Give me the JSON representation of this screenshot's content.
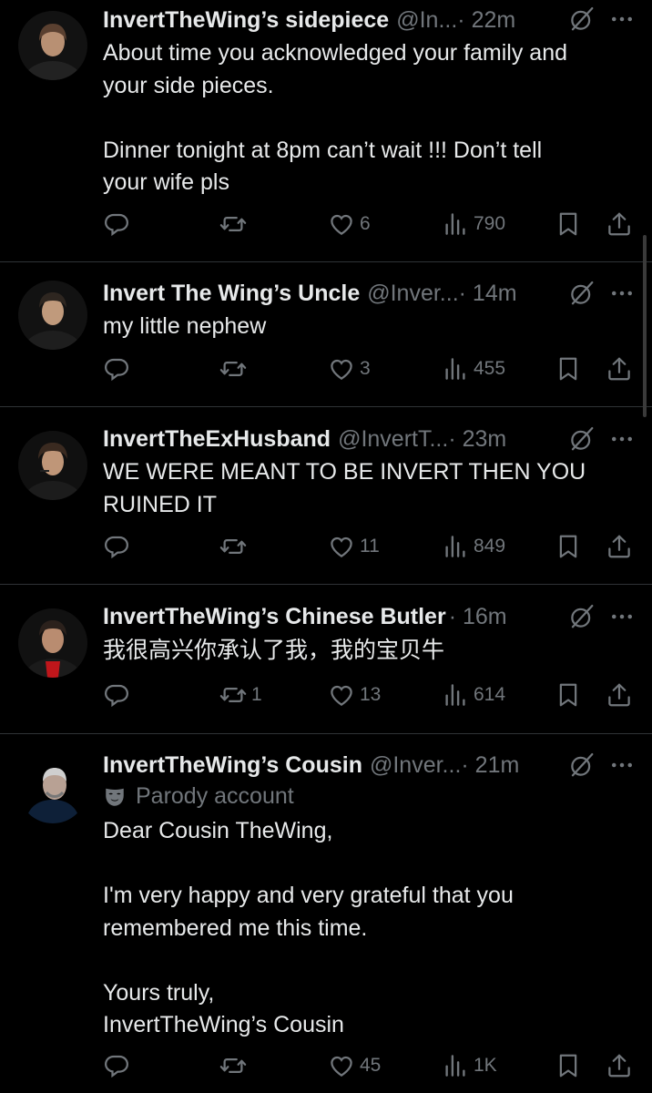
{
  "tweets": [
    {
      "name": "InvertTheWing’s sidepiece",
      "handle": "@In...",
      "time": "· 22m",
      "text": "About time you acknowledged your family and\nyour side pieces.\n\nDinner tonight at 8pm can’t wait !!! Don’t tell\nyour wife pls",
      "replies": "",
      "reposts": "",
      "likes": "6",
      "views": "790"
    },
    {
      "name": "Invert The Wing’s Uncle",
      "handle": "@Inver...",
      "time": "· 14m",
      "text": "my little nephew",
      "replies": "",
      "reposts": "",
      "likes": "3",
      "views": "455"
    },
    {
      "name": "InvertTheExHusband",
      "handle": "@InvertT...",
      "time": "· 23m",
      "text": "WE WERE MEANT TO BE INVERT THEN YOU\nRUINED IT",
      "replies": "",
      "reposts": "",
      "likes": "11",
      "views": "849"
    },
    {
      "name": "InvertTheWing’s Chinese Butler",
      "handle": "",
      "time": "· 16m",
      "text": "我很高兴你承认了我，我的宝贝牛",
      "replies": "",
      "reposts": "1",
      "likes": "13",
      "views": "614"
    },
    {
      "name": "InvertTheWing’s Cousin",
      "handle": "@Inver...",
      "time": "· 21m",
      "parody_label": "Parody account",
      "text": "Dear Cousin TheWing,\n\nI'm very happy and very grateful that you\nremembered me this time.\n\nYours truly,\nInvertTheWing’s Cousin",
      "replies": "",
      "reposts": "",
      "likes": "45",
      "views": "1K"
    }
  ],
  "icons": {
    "reply": "reply-icon",
    "repost": "repost-icon",
    "like": "heart-icon",
    "views": "views-icon",
    "bookmark": "bookmark-icon",
    "share": "share-icon",
    "grok": "grok-icon",
    "more": "more-icon",
    "parody": "theater-mask-icon"
  },
  "colors": {
    "background": "#000000",
    "text": "#e7e9ea",
    "muted": "#71767b",
    "divider": "#2f3336"
  }
}
